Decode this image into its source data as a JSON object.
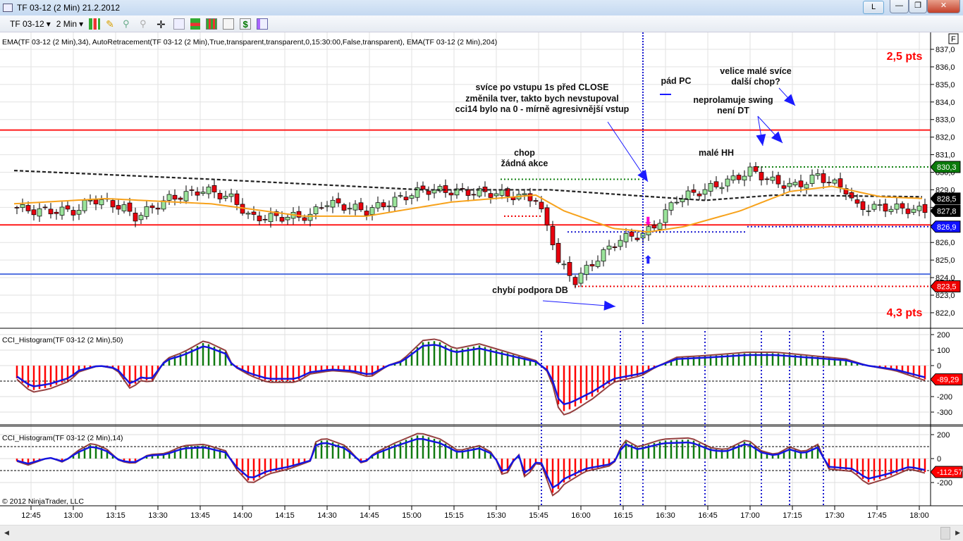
{
  "window": {
    "title": "TF 03-12 (2 Min)  21.2.2012",
    "l_button": "L",
    "minimize": "—",
    "restore": "❐",
    "close": "✕"
  },
  "toolbar": {
    "instrument": "TF 03-12",
    "interval": "2 Min",
    "icons": [
      "bar-style-icon",
      "drawing-pencil-icon",
      "zoom-in-icon",
      "zoom-out-icon",
      "crosshair-icon",
      "magnifier-icon",
      "indicators-icon",
      "strategies-icon",
      "chart-data-icon",
      "dollar-icon",
      "properties-icon"
    ]
  },
  "chart": {
    "indicator_label": "EMA(TF 03-12 (2 Min),34), AutoRetracement(TF 03-12 (2 Min),True,transparent,transparent,0,15:30:00,False,transparent), EMA(TF 03-12 (2 Min),204)",
    "panel1_label": "CCI_Histogram(TF 03-12 (2 Min),50)",
    "panel2_label": "CCI_Histogram(TF 03-12 (2 Min),14)",
    "copyright": "© 2012 NinjaTrader, LLC",
    "f_box": "F",
    "colors": {
      "up": "#9be49b",
      "down": "#e8000e",
      "ema34": "#f7a21b",
      "ema204": "#222222",
      "level_red": "#ff1a1a",
      "level_blue": "#4f6fe0",
      "cci_line": "#1515e0",
      "cci_pos": "#0f7a0f",
      "cci_neg": "#ff0000"
    }
  },
  "chart_data": {
    "type": "candlestick",
    "time_origin": "12:45",
    "time_unit": "minutes since 12:45",
    "price_ticks": [
      "837,0",
      "836,0",
      "835,0",
      "834,0",
      "833,0",
      "832,0",
      "831,0",
      "830,0",
      "829,0",
      "828,0",
      "827,0",
      "826,0",
      "825,0",
      "824,0",
      "823,0",
      "822,0"
    ],
    "price_range": [
      822,
      837
    ],
    "time_ticks": [
      "12:45",
      "13:00",
      "13:15",
      "13:30",
      "13:45",
      "14:00",
      "14:15",
      "14:30",
      "14:45",
      "15:00",
      "15:15",
      "15:30",
      "15:45",
      "16:00",
      "16:15",
      "16:30",
      "16:45",
      "17:00",
      "17:15",
      "17:30",
      "17:45",
      "18:00"
    ],
    "close_path": [
      [
        -6.5,
        828.0
      ],
      [
        1.5,
        827.8
      ],
      [
        16.5,
        827.8
      ],
      [
        21.5,
        828.5
      ],
      [
        32.75,
        828.0
      ],
      [
        36.5,
        827.4
      ],
      [
        49,
        828.5
      ],
      [
        61.5,
        829.0
      ],
      [
        71.5,
        828.5
      ],
      [
        77.75,
        827.4
      ],
      [
        99,
        827.5
      ],
      [
        104,
        828.3
      ],
      [
        119,
        827.8
      ],
      [
        139,
        829.0
      ],
      [
        164,
        828.8
      ],
      [
        179,
        828.5
      ],
      [
        185.25,
        826.0
      ],
      [
        186.5,
        825.0
      ],
      [
        192.75,
        823.8
      ],
      [
        201.5,
        825.2
      ],
      [
        209,
        826.2
      ],
      [
        217.75,
        826.5
      ],
      [
        221.5,
        827.0
      ],
      [
        229,
        828.5
      ],
      [
        239,
        829.0
      ],
      [
        249,
        829.6
      ],
      [
        255.25,
        830.1
      ],
      [
        264,
        829.4
      ],
      [
        271.5,
        829.2
      ],
      [
        279,
        829.8
      ],
      [
        289,
        829.0
      ],
      [
        292.75,
        828.0
      ],
      [
        304,
        828.0
      ],
      [
        317,
        827.8
      ]
    ],
    "ema204": [
      [
        -6.5,
        830.1
      ],
      [
        64,
        829.6
      ],
      [
        139,
        829.0
      ],
      [
        184,
        829.0
      ],
      [
        239,
        828.4
      ],
      [
        264,
        828.7
      ],
      [
        317,
        828.6
      ]
    ],
    "ema34": [
      [
        -6.5,
        828.2
      ],
      [
        26.5,
        828.5
      ],
      [
        64,
        828.2
      ],
      [
        96.5,
        827.5
      ],
      [
        119,
        827.5
      ],
      [
        149,
        828.3
      ],
      [
        179,
        828.7
      ],
      [
        189,
        827.8
      ],
      [
        206.5,
        826.8
      ],
      [
        219,
        826.6
      ],
      [
        231.5,
        826.9
      ],
      [
        251.5,
        827.8
      ],
      [
        269,
        828.9
      ],
      [
        284,
        829.2
      ],
      [
        301.5,
        828.6
      ],
      [
        317,
        828.5
      ]
    ],
    "levels": [
      {
        "price": 832.4,
        "color": "red"
      },
      {
        "price": 827.0,
        "color": "red"
      },
      {
        "price": 824.2,
        "color": "blue"
      }
    ],
    "dotted_levels": [
      {
        "price": 829.6,
        "from": 166.5,
        "to": 216.5,
        "color": "#108010"
      },
      {
        "price": 830.3,
        "from": 256.5,
        "to": 320,
        "color": "#108010"
      },
      {
        "price": 827.5,
        "from": 167.75,
        "to": 181.5,
        "color": "#e00"
      },
      {
        "price": 823.5,
        "from": 192.75,
        "to": 320,
        "color": "#e00"
      },
      {
        "price": 826.6,
        "from": 190.25,
        "to": 254,
        "color": "#1a1ad0"
      },
      {
        "price": 826.9,
        "from": 254,
        "to": 320,
        "color": "#1a1ad0"
      }
    ],
    "price_markers": [
      {
        "label": "830,3",
        "price": 830.3,
        "color": "#0a7a0a"
      },
      {
        "label": "828,5",
        "price": 828.5,
        "color": "#000"
      },
      {
        "label": "827,8",
        "price": 827.8,
        "color": "#000"
      },
      {
        "label": "826,9",
        "price": 826.9,
        "color": "#1010ff"
      },
      {
        "label": "823,5",
        "price": 823.5,
        "color": "#e00"
      }
    ],
    "main_vline": 217,
    "panel_vlines": [
      181,
      209,
      217,
      239,
      259,
      269,
      281
    ],
    "annotations": [
      {
        "text": "2,5 pts",
        "cls": "pts"
      },
      {
        "text": "4,3 pts",
        "cls": "pts"
      },
      {
        "text": "svíce po vstupu 1s před CLOSE"
      },
      {
        "text": "změnila tver, takto bych nevstupoval"
      },
      {
        "text": "cci14 bylo na 0 - mírně agresivnější vstup"
      },
      {
        "text": "pád PC"
      },
      {
        "text": "velice malé svíce"
      },
      {
        "text": "další chop?"
      },
      {
        "text": "neprolamuje swing"
      },
      {
        "text": "není DT"
      },
      {
        "text": "chop"
      },
      {
        "text": "žádná akce"
      },
      {
        "text": "malé HH"
      },
      {
        "text": "chybí podpora DB"
      }
    ],
    "cci50": {
      "ticks": [
        "200",
        "100",
        "0",
        "-200",
        "-300"
      ],
      "last": "-89,29",
      "points": [
        [
          -6.5,
          -60
        ],
        [
          0.25,
          -160
        ],
        [
          6.5,
          -140
        ],
        [
          14,
          -90
        ],
        [
          16.5,
          -40
        ],
        [
          24,
          0
        ],
        [
          30.25,
          -20
        ],
        [
          35.25,
          -140
        ],
        [
          39,
          -90
        ],
        [
          42.75,
          -100
        ],
        [
          47.75,
          40
        ],
        [
          54,
          80
        ],
        [
          61.5,
          150
        ],
        [
          69,
          90
        ],
        [
          71.5,
          0
        ],
        [
          77.75,
          -60
        ],
        [
          84,
          -100
        ],
        [
          94,
          -100
        ],
        [
          99,
          -50
        ],
        [
          106.5,
          -30
        ],
        [
          114,
          -40
        ],
        [
          120.25,
          -70
        ],
        [
          126.5,
          0
        ],
        [
          131.5,
          30
        ],
        [
          139,
          150
        ],
        [
          144,
          160
        ],
        [
          150.25,
          100
        ],
        [
          159,
          130
        ],
        [
          169,
          80
        ],
        [
          179,
          30
        ],
        [
          184,
          -50
        ],
        [
          187.75,
          -300
        ],
        [
          191.5,
          -280
        ],
        [
          199,
          -200
        ],
        [
          206.5,
          -100
        ],
        [
          211.5,
          -80
        ],
        [
          216.5,
          -60
        ],
        [
          221.5,
          -10
        ],
        [
          229,
          50
        ],
        [
          239,
          60
        ],
        [
          254,
          80
        ],
        [
          264,
          80
        ],
        [
          276.5,
          60
        ],
        [
          289,
          40
        ],
        [
          296.5,
          0
        ],
        [
          306.5,
          -30
        ],
        [
          317,
          -89
        ]
      ]
    },
    "cci14": {
      "ticks": [
        "200",
        "0",
        "-200"
      ],
      "last": "-112,57",
      "points": [
        [
          -6.5,
          -10
        ],
        [
          -1,
          -50
        ],
        [
          6.5,
          10
        ],
        [
          11.5,
          -30
        ],
        [
          16.5,
          60
        ],
        [
          21.5,
          120
        ],
        [
          26.5,
          80
        ],
        [
          31.5,
          -20
        ],
        [
          36.5,
          -40
        ],
        [
          41.5,
          30
        ],
        [
          47.75,
          40
        ],
        [
          54,
          100
        ],
        [
          61.5,
          110
        ],
        [
          69,
          60
        ],
        [
          72.75,
          -80
        ],
        [
          77.75,
          -200
        ],
        [
          84,
          -120
        ],
        [
          91.5,
          -80
        ],
        [
          99,
          -20
        ],
        [
          100.25,
          120
        ],
        [
          104,
          160
        ],
        [
          111.5,
          100
        ],
        [
          117.75,
          -50
        ],
        [
          121.5,
          40
        ],
        [
          129,
          120
        ],
        [
          137.75,
          200
        ],
        [
          145.25,
          150
        ],
        [
          151.5,
          60
        ],
        [
          159,
          100
        ],
        [
          164,
          40
        ],
        [
          167.75,
          -160
        ],
        [
          172.75,
          50
        ],
        [
          175.25,
          -160
        ],
        [
          180.25,
          0
        ],
        [
          185.25,
          -300
        ],
        [
          189,
          -200
        ],
        [
          196.5,
          -100
        ],
        [
          206.5,
          -50
        ],
        [
          210.25,
          150
        ],
        [
          215.25,
          90
        ],
        [
          224,
          150
        ],
        [
          234,
          160
        ],
        [
          241.5,
          80
        ],
        [
          246.5,
          70
        ],
        [
          254,
          150
        ],
        [
          259,
          60
        ],
        [
          264,
          30
        ],
        [
          269,
          90
        ],
        [
          274,
          50
        ],
        [
          279,
          110
        ],
        [
          282.75,
          -80
        ],
        [
          291.5,
          -100
        ],
        [
          296.5,
          -200
        ],
        [
          304,
          -150
        ],
        [
          311.5,
          -80
        ],
        [
          317,
          -112
        ]
      ]
    }
  }
}
